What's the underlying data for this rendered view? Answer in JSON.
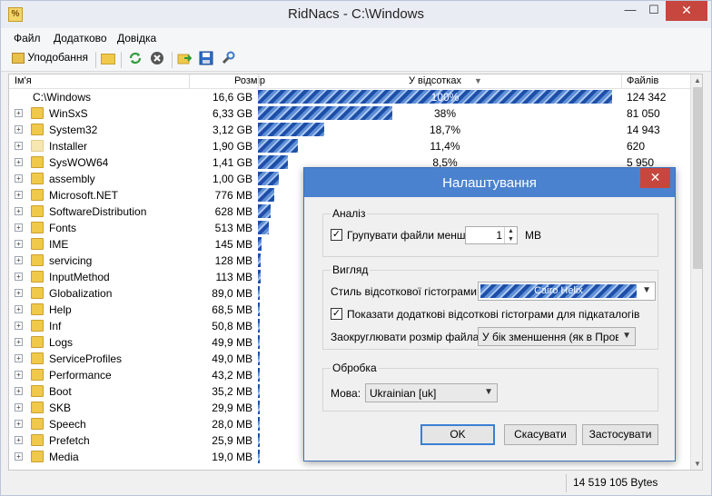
{
  "window": {
    "title": "RidNacs - C:\\Windows",
    "app_icon_glyph": "%"
  },
  "menu": [
    "Файл",
    "Додатково",
    "Довідка"
  ],
  "toolbar": {
    "favorites_label": "Уподобання"
  },
  "columns": {
    "name": "Ім'я",
    "size": "Розмір",
    "percent": "У відсотках",
    "files": "Файлів"
  },
  "rows": [
    {
      "name": "C:\\Windows",
      "size": "16,6 GB",
      "percent": "100%",
      "files": "124 342",
      "pct": 100
    },
    {
      "name": "WinSxS",
      "size": "6,33 GB",
      "percent": "38%",
      "files": "81 050",
      "pct": 38
    },
    {
      "name": "System32",
      "size": "3,12 GB",
      "percent": "18,7%",
      "files": "14 943",
      "pct": 18.7
    },
    {
      "name": "Installer",
      "size": "1,90 GB",
      "percent": "11,4%",
      "files": "620",
      "pct": 11.4
    },
    {
      "name": "SysWOW64",
      "size": "1,41 GB",
      "percent": "8,5%",
      "files": "5 950",
      "pct": 8.5
    },
    {
      "name": "assembly",
      "size": "1,00 GB",
      "percent": "",
      "files": "",
      "pct": 6.0
    },
    {
      "name": "Microsoft.NET",
      "size": "776 MB",
      "percent": "",
      "files": "",
      "pct": 4.6
    },
    {
      "name": "SoftwareDistribution",
      "size": "628 MB",
      "percent": "",
      "files": "",
      "pct": 3.7
    },
    {
      "name": "Fonts",
      "size": "513 MB",
      "percent": "",
      "files": "",
      "pct": 3.0
    },
    {
      "name": "IME",
      "size": "145 MB",
      "percent": "",
      "files": "",
      "pct": 0.9
    },
    {
      "name": "servicing",
      "size": "128 MB",
      "percent": "",
      "files": "",
      "pct": 0.8
    },
    {
      "name": "InputMethod",
      "size": "113 MB",
      "percent": "",
      "files": "",
      "pct": 0.7
    },
    {
      "name": "Globalization",
      "size": "89,0 MB",
      "percent": "",
      "files": "",
      "pct": 0.5
    },
    {
      "name": "Help",
      "size": "68,5 MB",
      "percent": "",
      "files": "",
      "pct": 0.4
    },
    {
      "name": "Inf",
      "size": "50,8 MB",
      "percent": "",
      "files": "",
      "pct": 0.3
    },
    {
      "name": "Logs",
      "size": "49,9 MB",
      "percent": "",
      "files": "",
      "pct": 0.3
    },
    {
      "name": "ServiceProfiles",
      "size": "49,0 MB",
      "percent": "",
      "files": "",
      "pct": 0.3
    },
    {
      "name": "Performance",
      "size": "43,2 MB",
      "percent": "",
      "files": "",
      "pct": 0.25
    },
    {
      "name": "Boot",
      "size": "35,2 MB",
      "percent": "",
      "files": "",
      "pct": 0.2
    },
    {
      "name": "SKB",
      "size": "29,9 MB",
      "percent": "",
      "files": "",
      "pct": 0.2
    },
    {
      "name": "Speech",
      "size": "28,0 MB",
      "percent": "",
      "files": "",
      "pct": 0.2
    },
    {
      "name": "Prefetch",
      "size": "25,9 MB",
      "percent": "",
      "files": "",
      "pct": 0.15
    },
    {
      "name": "Media",
      "size": "19,0 MB",
      "percent": "",
      "files": "",
      "pct": 0.1
    }
  ],
  "status": {
    "bytes": "14 519 105 Bytes"
  },
  "dialog": {
    "title": "Налаштування",
    "analysis": {
      "label": "Аналіз",
      "group_small": "Групувати файли менше:",
      "group_small_value": "1",
      "group_small_unit": "MB",
      "checked": true
    },
    "view": {
      "label": "Вигляд",
      "style_label": "Стиль відсоткової гістограми:",
      "style_value": "Cairo Helix",
      "show_sub": "Показати додаткові відсоткові гістограми для підкаталогів",
      "show_sub_checked": true,
      "round_label": "Заокруглювати розмір файла:",
      "round_value": "У бік зменшення (як в Провід"
    },
    "processing": {
      "label": "Обробка",
      "lang_label": "Мова:",
      "lang_value": "Ukrainian [uk]"
    },
    "buttons": {
      "ok": "OK",
      "cancel": "Скасувати",
      "apply": "Застосувати"
    }
  }
}
